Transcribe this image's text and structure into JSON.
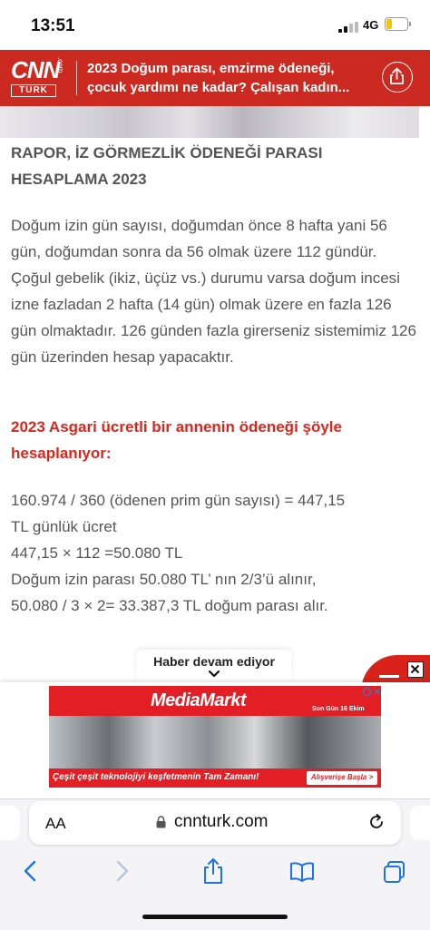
{
  "status_bar": {
    "time": "13:51",
    "network": "4G",
    "battery_level": 0.28
  },
  "header": {
    "logo": {
      "brand": "CNN",
      "sub": "TÜRK",
      "tld": ".com"
    },
    "title": "2023 Doğum parası, emzirme ödeneği, çocuk yardımı ne kadar? Çalışan kadın...",
    "title_line1": "2023 Doğum parası, emzirme ödeneği,",
    "title_line2": "çocuk yardımı ne kadar? Çalışan kadın..."
  },
  "article": {
    "heading": "RAPOR, İZ GÖRMEZLİK ÖDENEĞİ PARASI HESAPLAMA 2023",
    "paragraph": "Doğum izin gün sayısı, doğumdan önce 8 hafta yani 56 gün, doğumdan sonra da 56 olmak üzere 112 gündür. Çoğul gebelik (ikiz, üçüz vs.) durumu varsa doğum incesi izne fazladan 2 hafta (14 gün) olmak üzere en fazla 126 gün olmaktadır. 126 günden fazla girerseniz sistemimiz 126 gün üzerinden hesap yapacaktır.",
    "red_heading": "2023 Asgari ücretli bir annenin ödeneği şöyle hesaplanıyor:",
    "calc_lines": [
      "160.974 / 360  (ödenen prim gün sayısı) = 447,15",
      "TL günlük ücret",
      "447,15 × 112 =50.080 TL",
      "Doğum izin parası 50.080 TL’ nın 2/3’ü alınır,",
      "50.080 / 3 × 2= 33.387,3 TL doğum parası alır."
    ],
    "continue_label": "Haber devam ediyor"
  },
  "ad": {
    "brand": "MediaMarkt",
    "date_note": "Son Gün 16 Ekim",
    "slogan": "Çeşit çeşit teknolojiyi keşfetmenin Tam Zamanı!",
    "cta": "Alışverişe Başla >"
  },
  "browser": {
    "aa_label": "AA",
    "url": "cnnturk.com"
  },
  "colors": {
    "brand_red": "#cc2a20",
    "highlight_red": "#e0241b",
    "body_text": "#555555",
    "ios_blue": "#1a73e8"
  }
}
